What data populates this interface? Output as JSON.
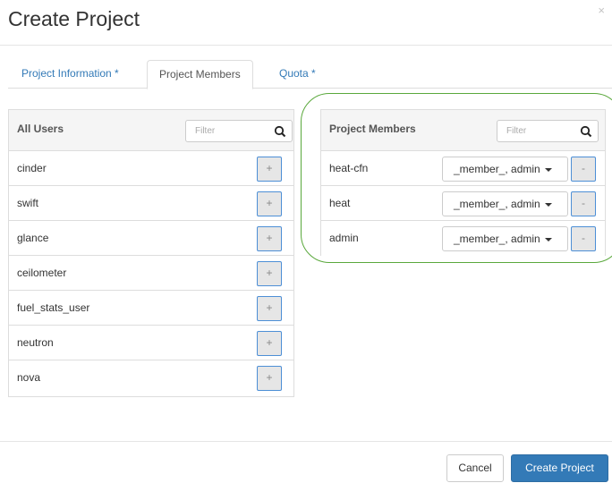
{
  "modal": {
    "title": "Create Project",
    "close_symbol": "×"
  },
  "tabs": [
    {
      "label": "Project Information *",
      "active": false
    },
    {
      "label": "Project Members",
      "active": true
    },
    {
      "label": "Quota *",
      "active": false
    }
  ],
  "all_users": {
    "title": "All Users",
    "filter_placeholder": "Filter",
    "add_label": "+",
    "users": [
      "cinder",
      "swift",
      "glance",
      "ceilometer",
      "fuel_stats_user",
      "neutron",
      "nova"
    ]
  },
  "project_members": {
    "title": "Project Members",
    "filter_placeholder": "Filter",
    "remove_label": "-",
    "members": [
      {
        "name": "heat-cfn",
        "roles": "_member_, admin"
      },
      {
        "name": "heat",
        "roles": "_member_, admin"
      },
      {
        "name": "admin",
        "roles": "_member_, admin"
      }
    ]
  },
  "footer": {
    "cancel_label": "Cancel",
    "submit_label": "Create Project"
  },
  "colors": {
    "primary": "#337ab7",
    "highlight": "#5aa83c",
    "link": "#337ab7"
  },
  "icons": {
    "filter": "search-icon",
    "dropdown": "caret-down-icon",
    "close": "close-icon"
  }
}
